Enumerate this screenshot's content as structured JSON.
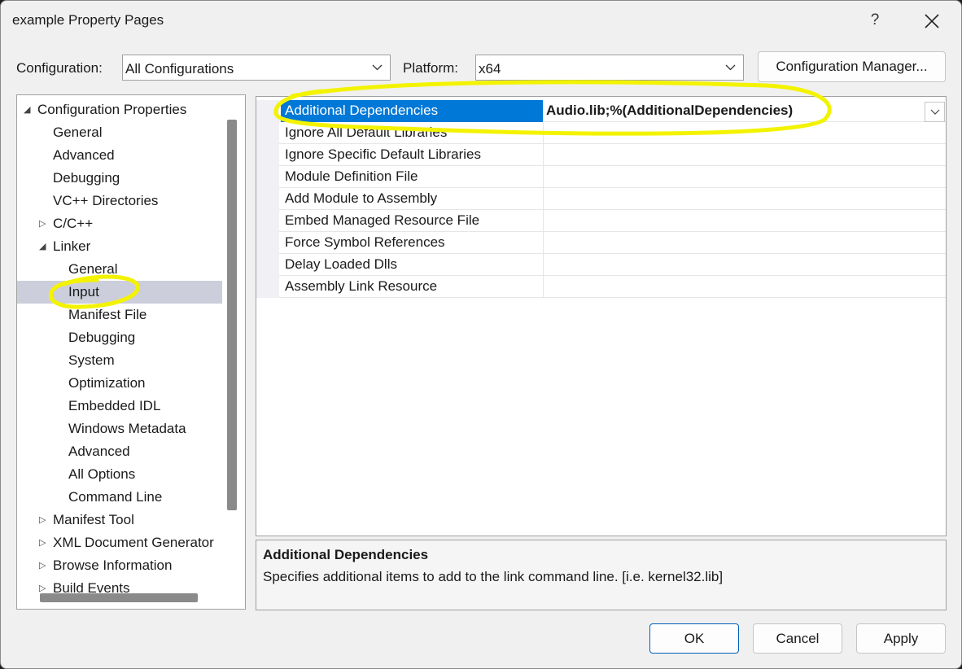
{
  "window": {
    "title": "example Property Pages",
    "help_glyph": "?",
    "close_icon": "close-icon"
  },
  "config_row": {
    "configuration_label": "Configuration:",
    "configuration_value": "All Configurations",
    "platform_label": "Platform:",
    "platform_value": "x64",
    "config_manager_label": "Configuration Manager..."
  },
  "tree": {
    "items": [
      {
        "label": "Configuration Properties",
        "expander": "◢"
      },
      {
        "label": "General"
      },
      {
        "label": "Advanced"
      },
      {
        "label": "Debugging"
      },
      {
        "label": "VC++ Directories"
      },
      {
        "label": "C/C++",
        "expander": "▷"
      },
      {
        "label": "Linker",
        "expander": "◢"
      },
      {
        "label": "General"
      },
      {
        "label": "Input",
        "selected": true
      },
      {
        "label": "Manifest File"
      },
      {
        "label": "Debugging"
      },
      {
        "label": "System"
      },
      {
        "label": "Optimization"
      },
      {
        "label": "Embedded IDL"
      },
      {
        "label": "Windows Metadata"
      },
      {
        "label": "Advanced"
      },
      {
        "label": "All Options"
      },
      {
        "label": "Command Line"
      },
      {
        "label": "Manifest Tool",
        "expander": "▷"
      },
      {
        "label": "XML Document Generator",
        "expander": "▷"
      },
      {
        "label": "Browse Information",
        "expander": "▷"
      },
      {
        "label": "Build Events",
        "expander": "▷"
      }
    ]
  },
  "properties": [
    {
      "name": "Additional Dependencies",
      "value": "Audio.lib;%(AdditionalDependencies)",
      "selected": true
    },
    {
      "name": "Ignore All Default Libraries",
      "value": ""
    },
    {
      "name": "Ignore Specific Default Libraries",
      "value": ""
    },
    {
      "name": "Module Definition File",
      "value": ""
    },
    {
      "name": "Add Module to Assembly",
      "value": ""
    },
    {
      "name": "Embed Managed Resource File",
      "value": ""
    },
    {
      "name": "Force Symbol References",
      "value": ""
    },
    {
      "name": "Delay Loaded Dlls",
      "value": ""
    },
    {
      "name": "Assembly Link Resource",
      "value": ""
    }
  ],
  "description": {
    "title": "Additional Dependencies",
    "text": "Specifies additional items to add to the link command line. [i.e. kernel32.lib]"
  },
  "buttons": {
    "ok": "OK",
    "cancel": "Cancel",
    "apply": "Apply"
  },
  "colors": {
    "selection_blue": "#0078d7",
    "tree_selection": "#cccedb",
    "highlighter": "#f3f300"
  }
}
